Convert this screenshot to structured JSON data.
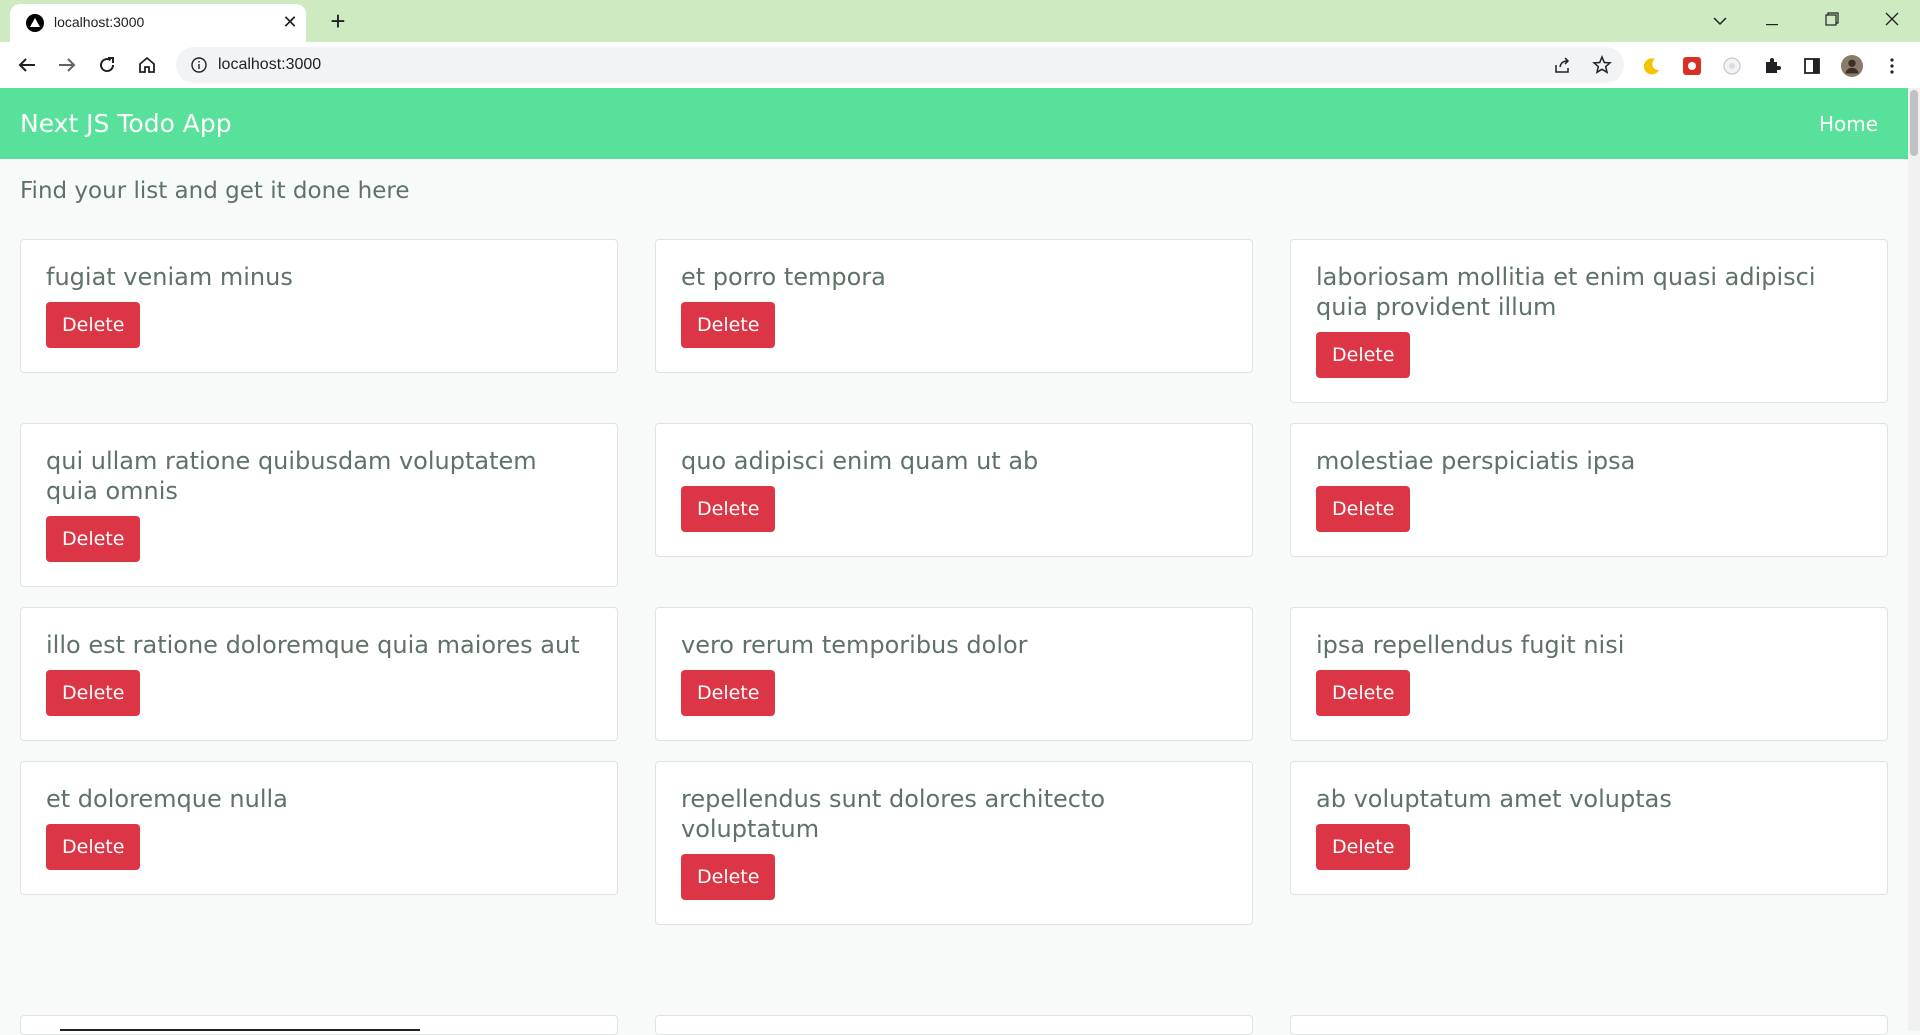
{
  "browser": {
    "tab_title": "localhost:3000",
    "url": "localhost:3000"
  },
  "navbar": {
    "brand": "Next JS Todo App",
    "home_link": "Home"
  },
  "page": {
    "subtitle": "Find your list and get it done here"
  },
  "todos": [
    {
      "title": "fugiat veniam minus",
      "button": "Delete"
    },
    {
      "title": "et porro tempora",
      "button": "Delete"
    },
    {
      "title": "laboriosam mollitia et enim quasi adipisci quia provident illum",
      "button": "Delete"
    },
    {
      "title": "qui ullam ratione quibusdam voluptatem quia omnis",
      "button": "Delete"
    },
    {
      "title": "quo adipisci enim quam ut ab",
      "button": "Delete"
    },
    {
      "title": "molestiae perspiciatis ipsa",
      "button": "Delete"
    },
    {
      "title": "illo est ratione doloremque quia maiores aut",
      "button": "Delete"
    },
    {
      "title": "vero rerum temporibus dolor",
      "button": "Delete"
    },
    {
      "title": "ipsa repellendus fugit nisi",
      "button": "Delete"
    },
    {
      "title": "et doloremque nulla",
      "button": "Delete"
    },
    {
      "title": "repellendus sunt dolores architecto voluptatum",
      "button": "Delete"
    },
    {
      "title": "ab voluptatum amet voluptas",
      "button": "Delete"
    }
  ],
  "colors": {
    "navbar": "#58e19a",
    "delete_button": "#dc3545",
    "tabstrip": "#cdeac0"
  }
}
